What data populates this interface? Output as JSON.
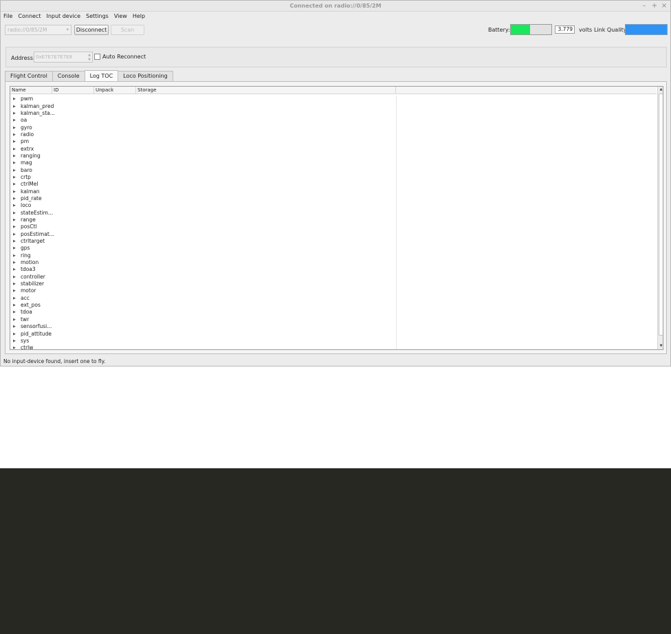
{
  "window": {
    "title": "Connected on radio://0/85/2M",
    "controls": {
      "minimize": "–",
      "maximize": "+",
      "close": "×"
    }
  },
  "menubar": {
    "items": [
      "File",
      "Connect",
      "Input device",
      "Settings",
      "View",
      "Help"
    ]
  },
  "toolbar": {
    "radio_uri": "radio://0/85/2M",
    "disconnect_label": "Disconnect",
    "scan_label": "Scan",
    "battery_label": "Battery:",
    "battery_level": 0.48,
    "battery_color": "#18e85a",
    "voltage": "3.779",
    "volts_label": "volts",
    "link_quality_label": "Link Quality:",
    "link_quality_level": 1.0,
    "link_quality_color": "#2f93f5"
  },
  "address": {
    "label": "Address:",
    "value": "0xE7E7E7E7E8",
    "auto_reconnect_label": "Auto Reconnect",
    "auto_reconnect_checked": false
  },
  "tabs": [
    {
      "label": "Flight Control",
      "active": false
    },
    {
      "label": "Console",
      "active": false
    },
    {
      "label": "Log TOC",
      "active": true
    },
    {
      "label": "Loco Positioning",
      "active": false
    }
  ],
  "log_toc": {
    "columns": [
      "Name",
      "ID",
      "Unpack",
      "Storage"
    ],
    "rows": [
      "pwm",
      "kalman_pred",
      "kalman_sta...",
      "oa",
      "gyro",
      "radio",
      "pm",
      "extrx",
      "ranging",
      "mag",
      "baro",
      "crtp",
      "ctrlMel",
      "kalman",
      "pid_rate",
      "loco",
      "stateEstim...",
      "range",
      "posCtl",
      "posEstimat...",
      "ctrltarget",
      "gps",
      "ring",
      "motion",
      "tdoa3",
      "controller",
      "stabilizer",
      "motor",
      "acc",
      "ext_pos",
      "tdoa",
      "twr",
      "sensorfusi...",
      "pid_attitude",
      "sys",
      "ctrlw"
    ]
  },
  "statusbar": {
    "text": "No input-device found, insert one to fly."
  },
  "terminal": {
    "background": "#272822"
  }
}
